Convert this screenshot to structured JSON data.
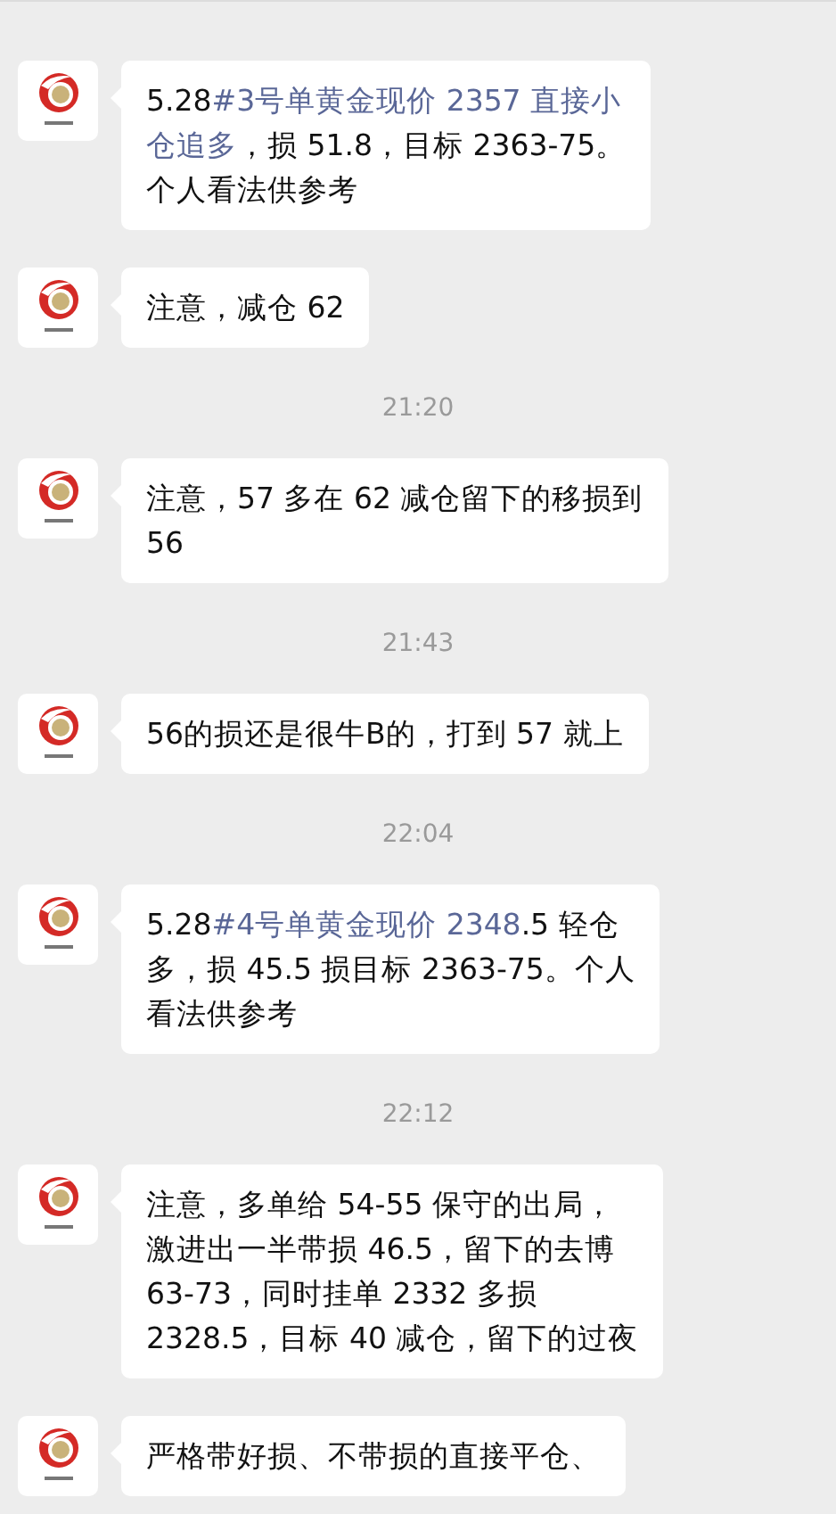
{
  "messages": [
    {
      "kind": "message",
      "lines": [
        [
          {
            "text": "5.28",
            "link": false
          },
          {
            "text": "#3号单黄金现价 2357 直接小",
            "link": true
          }
        ],
        [
          {
            "text": "仓追多",
            "link": true
          },
          {
            "text": "，损 51.8，目标 2363-75。",
            "link": false
          }
        ],
        [
          {
            "text": "个人看法供参考",
            "link": false
          }
        ]
      ]
    },
    {
      "kind": "message",
      "lines": [
        [
          {
            "text": "注意，减仓 62",
            "link": false
          }
        ]
      ]
    },
    {
      "kind": "time",
      "text": "21:20"
    },
    {
      "kind": "message",
      "lines": [
        [
          {
            "text": "注意，57 多在 62 减仓留下的移损到",
            "link": false
          }
        ],
        [
          {
            "text": "56",
            "link": false
          }
        ]
      ]
    },
    {
      "kind": "time",
      "text": "21:43"
    },
    {
      "kind": "message",
      "lines": [
        [
          {
            "text": "56的损还是很牛B的，打到 57 就上",
            "link": false
          }
        ]
      ]
    },
    {
      "kind": "time",
      "text": "22:04"
    },
    {
      "kind": "message",
      "lines": [
        [
          {
            "text": "5.28",
            "link": false
          },
          {
            "text": "#4号单黄金现价 2348",
            "link": true
          },
          {
            "text": ".5 轻仓",
            "link": false
          }
        ],
        [
          {
            "text": "多，损 45.5 损目标 2363-75。个人",
            "link": false
          }
        ],
        [
          {
            "text": "看法供参考",
            "link": false
          }
        ]
      ]
    },
    {
      "kind": "time",
      "text": "22:12"
    },
    {
      "kind": "message",
      "lines": [
        [
          {
            "text": "注意，多单给 54-55 保守的出局，",
            "link": false
          }
        ],
        [
          {
            "text": "激进出一半带损 46.5，留下的去博",
            "link": false
          }
        ],
        [
          {
            "text": "63-73，同时挂单 2332 多损",
            "link": false
          }
        ],
        [
          {
            "text": "2328.5，目标 40 减仓，留下的过夜",
            "link": false
          }
        ]
      ]
    },
    {
      "kind": "message",
      "lines": [
        [
          {
            "text": "严格带好损、不带损的直接平仓、",
            "link": false
          }
        ]
      ]
    }
  ]
}
